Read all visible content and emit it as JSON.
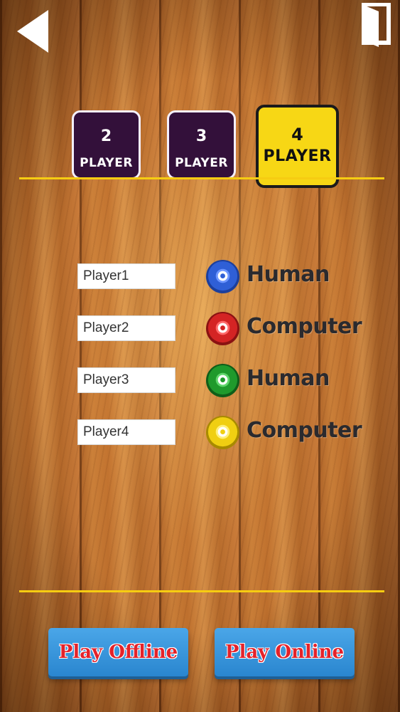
{
  "header": {
    "back_icon": "back-arrow-icon",
    "exit_icon": "exit-door-icon"
  },
  "player_count": {
    "options": [
      {
        "number": "2",
        "label": "PLAYER"
      },
      {
        "number": "3",
        "label": "PLAYER"
      },
      {
        "number": "4",
        "label": "PLAYER"
      }
    ],
    "selected": "4"
  },
  "players": [
    {
      "name": "Player1",
      "color": "#2f5fd6",
      "token_color_name": "blue",
      "type": "Human"
    },
    {
      "name": "Player2",
      "color": "#d42424",
      "token_color_name": "red",
      "type": "Computer"
    },
    {
      "name": "Player3",
      "color": "#1f9a2c",
      "token_color_name": "green",
      "type": "Human"
    },
    {
      "name": "Player4",
      "color": "#f0cf12",
      "token_color_name": "yellow",
      "type": "Computer"
    }
  ],
  "footer": {
    "play_offline": "Play Offline",
    "play_online": "Play Online"
  },
  "colors": {
    "accent_yellow": "#f7d715",
    "unselected_purple": "#33103a",
    "play_button_blue": "#3a97dc",
    "play_text_red": "#e4222a"
  }
}
